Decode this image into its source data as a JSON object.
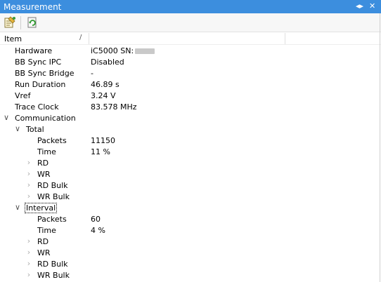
{
  "window": {
    "title": "Measurement",
    "pin_glyph": "◂▸",
    "close_glyph": "✕"
  },
  "toolbar": {
    "buttons": [
      {
        "icon": "properties-icon"
      },
      {
        "icon": "refresh-icon"
      }
    ]
  },
  "columns": {
    "item": "Item",
    "sort_indicator": "/"
  },
  "rows": [
    {
      "label": "Hardware",
      "value": "iC5000  SN:"
    },
    {
      "label": "BB Sync IPC",
      "value": "Disabled"
    },
    {
      "label": "BB Sync Bridge",
      "value": "-"
    },
    {
      "label": "Run Duration",
      "value": "46.89 s"
    },
    {
      "label": "Vref",
      "value": "3.24 V"
    },
    {
      "label": "Trace Clock",
      "value": "83.578 MHz"
    },
    {
      "label": "Communication",
      "value": ""
    },
    {
      "label": "Total",
      "value": ""
    },
    {
      "label": "Packets",
      "value": "11150"
    },
    {
      "label": "Time",
      "value": "11 %"
    },
    {
      "label": "RD",
      "value": ""
    },
    {
      "label": "WR",
      "value": ""
    },
    {
      "label": "RD Bulk",
      "value": ""
    },
    {
      "label": "WR Bulk",
      "value": ""
    },
    {
      "label": "Interval",
      "value": ""
    },
    {
      "label": "Packets",
      "value": "60"
    },
    {
      "label": "Time",
      "value": "4 %"
    },
    {
      "label": "RD",
      "value": ""
    },
    {
      "label": "WR",
      "value": ""
    },
    {
      "label": "RD Bulk",
      "value": ""
    },
    {
      "label": "WR Bulk",
      "value": ""
    }
  ],
  "chevrons": {
    "expanded": "∨",
    "collapsed": "›"
  },
  "colors": {
    "titlebar": "#3c8ede",
    "toolbar": "#f7f7f7"
  }
}
